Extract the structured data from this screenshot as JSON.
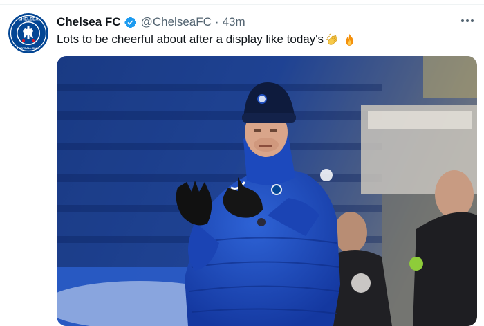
{
  "tweet": {
    "author": {
      "display_name": "Chelsea FC",
      "handle": "@ChelseaFC",
      "verified": true,
      "avatar_icon": "chelsea-crest-icon",
      "avatar_text_top": "CHELSEA",
      "avatar_text_bottom": "FOOTBALL CLUB"
    },
    "separator": "·",
    "timestamp": "43m",
    "text": "Lots to be cheerful about after a display like today's",
    "emojis": [
      "clapping-hands-icon",
      "fire-icon"
    ],
    "media": {
      "kind": "photo"
    }
  },
  "colors": {
    "verified_blue": "#1d9bf0",
    "chelsea_blue": "#034694",
    "muted_text": "#536471"
  }
}
